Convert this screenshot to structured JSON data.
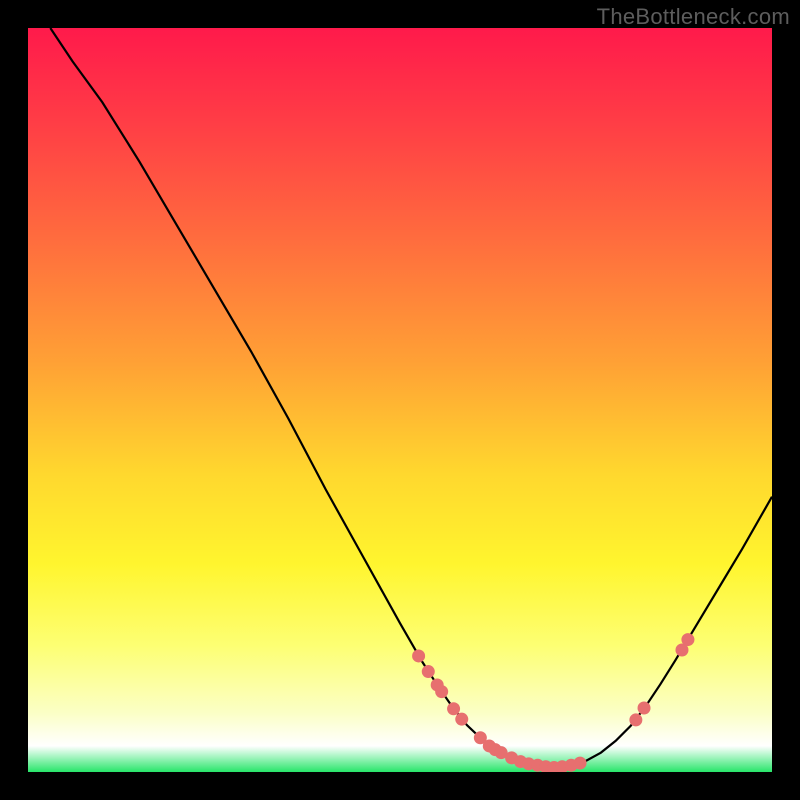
{
  "watermark": "TheBottleneck.com",
  "chart_data": {
    "type": "line",
    "title": "",
    "xlabel": "",
    "ylabel": "",
    "xlim": [
      0,
      100
    ],
    "ylim": [
      0,
      100
    ],
    "gradient_stops": [
      {
        "offset": 0,
        "color": "#ff1a4b"
      },
      {
        "offset": 0.12,
        "color": "#ff3b46"
      },
      {
        "offset": 0.28,
        "color": "#ff6b3e"
      },
      {
        "offset": 0.45,
        "color": "#ffa135"
      },
      {
        "offset": 0.6,
        "color": "#ffd82e"
      },
      {
        "offset": 0.72,
        "color": "#fff52e"
      },
      {
        "offset": 0.83,
        "color": "#fdff73"
      },
      {
        "offset": 0.92,
        "color": "#fbffc5"
      },
      {
        "offset": 0.965,
        "color": "#ffffff"
      },
      {
        "offset": 1.0,
        "color": "#28e66a"
      }
    ],
    "curve": [
      {
        "x": 3.0,
        "y": 100.0
      },
      {
        "x": 6.0,
        "y": 95.5
      },
      {
        "x": 10.0,
        "y": 90.0
      },
      {
        "x": 15.0,
        "y": 82.0
      },
      {
        "x": 20.0,
        "y": 73.5
      },
      {
        "x": 25.0,
        "y": 65.0
      },
      {
        "x": 30.0,
        "y": 56.5
      },
      {
        "x": 35.0,
        "y": 47.5
      },
      {
        "x": 40.0,
        "y": 38.0
      },
      {
        "x": 45.0,
        "y": 29.0
      },
      {
        "x": 50.0,
        "y": 20.0
      },
      {
        "x": 53.0,
        "y": 14.8
      },
      {
        "x": 55.0,
        "y": 11.7
      },
      {
        "x": 57.0,
        "y": 8.8
      },
      {
        "x": 59.0,
        "y": 6.3
      },
      {
        "x": 61.0,
        "y": 4.4
      },
      {
        "x": 63.0,
        "y": 2.9
      },
      {
        "x": 65.0,
        "y": 1.9
      },
      {
        "x": 67.0,
        "y": 1.2
      },
      {
        "x": 69.0,
        "y": 0.8
      },
      {
        "x": 71.0,
        "y": 0.6
      },
      {
        "x": 73.0,
        "y": 0.9
      },
      {
        "x": 75.0,
        "y": 1.5
      },
      {
        "x": 77.0,
        "y": 2.6
      },
      {
        "x": 79.0,
        "y": 4.2
      },
      {
        "x": 81.0,
        "y": 6.2
      },
      {
        "x": 83.0,
        "y": 8.8
      },
      {
        "x": 85.0,
        "y": 11.8
      },
      {
        "x": 87.0,
        "y": 15.0
      },
      {
        "x": 90.0,
        "y": 20.0
      },
      {
        "x": 93.0,
        "y": 25.0
      },
      {
        "x": 96.0,
        "y": 30.0
      },
      {
        "x": 100.0,
        "y": 37.0
      }
    ],
    "markers": [
      {
        "x": 52.5,
        "y": 15.6
      },
      {
        "x": 53.8,
        "y": 13.5
      },
      {
        "x": 55.0,
        "y": 11.7
      },
      {
        "x": 55.6,
        "y": 10.8
      },
      {
        "x": 57.2,
        "y": 8.5
      },
      {
        "x": 58.3,
        "y": 7.1
      },
      {
        "x": 60.8,
        "y": 4.6
      },
      {
        "x": 62.0,
        "y": 3.5
      },
      {
        "x": 62.8,
        "y": 3.0
      },
      {
        "x": 63.6,
        "y": 2.6
      },
      {
        "x": 65.0,
        "y": 1.9
      },
      {
        "x": 66.2,
        "y": 1.4
      },
      {
        "x": 67.3,
        "y": 1.1
      },
      {
        "x": 68.5,
        "y": 0.9
      },
      {
        "x": 69.6,
        "y": 0.7
      },
      {
        "x": 70.7,
        "y": 0.6
      },
      {
        "x": 71.8,
        "y": 0.7
      },
      {
        "x": 73.0,
        "y": 0.9
      },
      {
        "x": 74.2,
        "y": 1.2
      },
      {
        "x": 81.7,
        "y": 7.0
      },
      {
        "x": 82.8,
        "y": 8.6
      },
      {
        "x": 87.9,
        "y": 16.4
      },
      {
        "x": 88.7,
        "y": 17.8
      }
    ],
    "marker_color": "#e76f6f",
    "curve_color": "#000000"
  }
}
